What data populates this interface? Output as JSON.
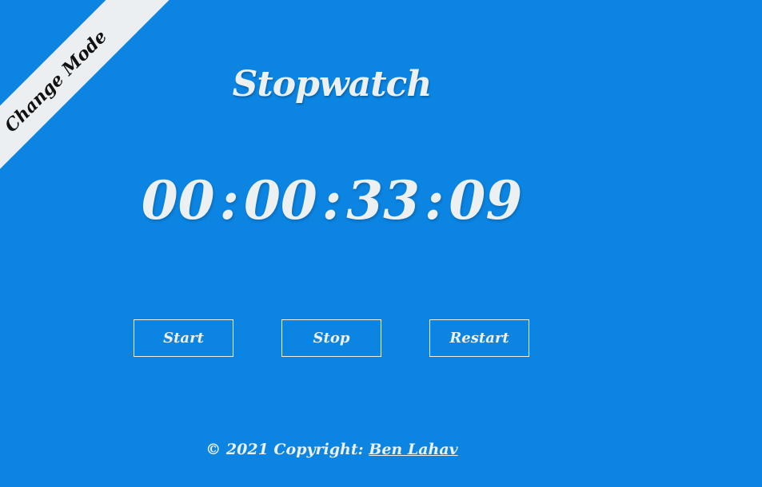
{
  "ribbon": {
    "label": "Change Mode"
  },
  "app": {
    "title": "Stopwatch"
  },
  "timer": {
    "hours": "00",
    "minutes": "00",
    "seconds": "33",
    "centiseconds": "09",
    "separator": ":"
  },
  "controls": {
    "start_label": "Start",
    "stop_label": "Stop",
    "restart_label": "Restart"
  },
  "footer": {
    "copyright_text": "© 2021 Copyright: ",
    "author_link": "Ben Lahav"
  },
  "colors": {
    "background": "#0b84e2",
    "text": "#ecf0f1",
    "ribbon": "#eceff1"
  }
}
